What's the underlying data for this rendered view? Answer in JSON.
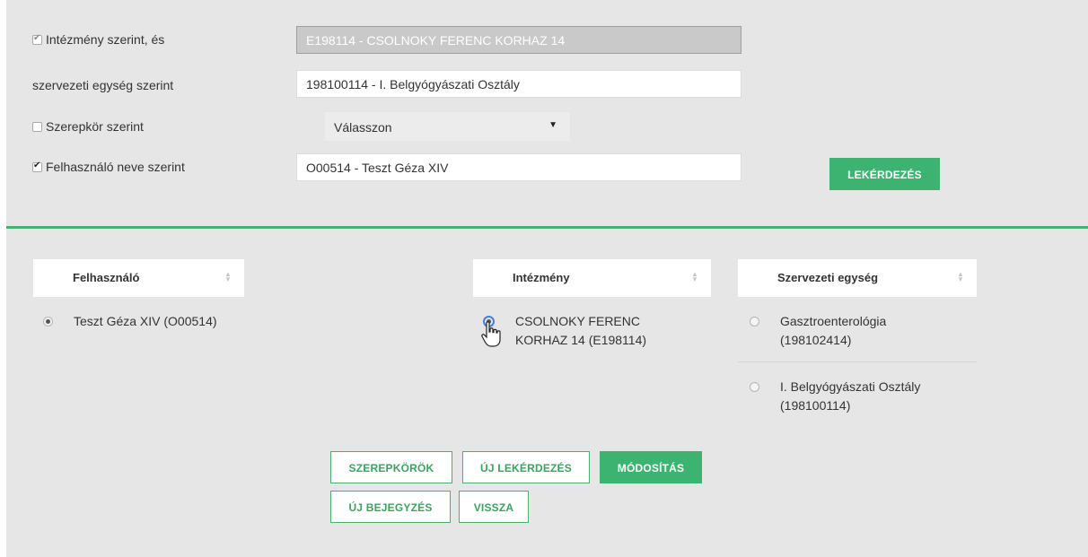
{
  "filters": {
    "institution": {
      "label": "Intézmény szerint, és",
      "checked": true,
      "value": "E198114 - CSOLNOKY FERENC KORHAZ 14"
    },
    "unit": {
      "label": "szervezeti egység szerint",
      "value": "198100114 - I. Belgyógyászati Osztály"
    },
    "role": {
      "label": "Szerepkör szerint",
      "checked": false,
      "select_value": "Válasszon"
    },
    "user": {
      "label": "Felhasználó neve szerint",
      "checked": true,
      "value": "O00514 - Teszt Géza XIV"
    },
    "query_button": "LEKÉRDEZÉS"
  },
  "tables": {
    "user": {
      "header": "Felhasználó",
      "rows": [
        {
          "text": "Teszt Géza XIV (O00514)",
          "selected": true
        }
      ]
    },
    "institution": {
      "header": "Intézmény",
      "rows": [
        {
          "line1": "CSOLNOKY FERENC",
          "line2": "KORHAZ 14 (E198114)",
          "selected": true
        }
      ]
    },
    "unit": {
      "header": "Szervezeti egység",
      "rows": [
        {
          "line1": "Gasztroenterológia",
          "line2": "(198102414)",
          "selected": false
        },
        {
          "line1": "I. Belgyógyászati Osztály",
          "line2": "(198100114)",
          "selected": false
        }
      ]
    }
  },
  "actions": {
    "roles": "SZEREPKÖRÖK",
    "new_query": "ÚJ LEKÉRDEZÉS",
    "modify": "MÓDOSÍTÁS",
    "new_entry": "ÚJ BEJEGYZÉS",
    "back": "VISSZA"
  },
  "colors": {
    "accent_green": "#3cb371",
    "panel_background": "#e6e6e6",
    "disabled_field": "#c9c9c9"
  },
  "icons": {
    "sort": "sort-icon",
    "caret": "caret-down-icon",
    "cursor": "hand-pointer-icon"
  }
}
